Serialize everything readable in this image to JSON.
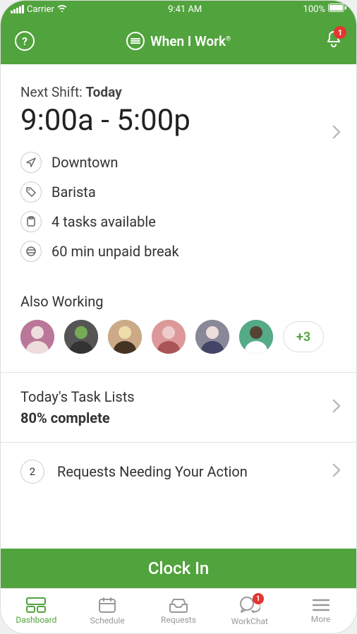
{
  "status": {
    "carrier": "Carrier",
    "time": "9:41 AM",
    "battery": "100%"
  },
  "nav": {
    "brand": "When I Work",
    "brand_sup": "®",
    "bell_badge": "1"
  },
  "shift": {
    "next_prefix": "Next Shift: ",
    "next_day": "Today",
    "time": "9:00a - 5:00p",
    "location": "Downtown",
    "role": "Barista",
    "tasks": "4 tasks available",
    "break": "60 min unpaid break"
  },
  "also_working": {
    "title": "Also Working",
    "more": "+3"
  },
  "tasks": {
    "title": "Today's Task Lists",
    "sub": "80% complete"
  },
  "requests": {
    "count": "2",
    "title": "Requests Needing Your Action"
  },
  "clock_in": "Clock In",
  "tabs": {
    "dashboard": "Dashboard",
    "schedule": "Schedule",
    "requests": "Requests",
    "workchat": "WorkChat",
    "workchat_badge": "1",
    "more": "More"
  }
}
